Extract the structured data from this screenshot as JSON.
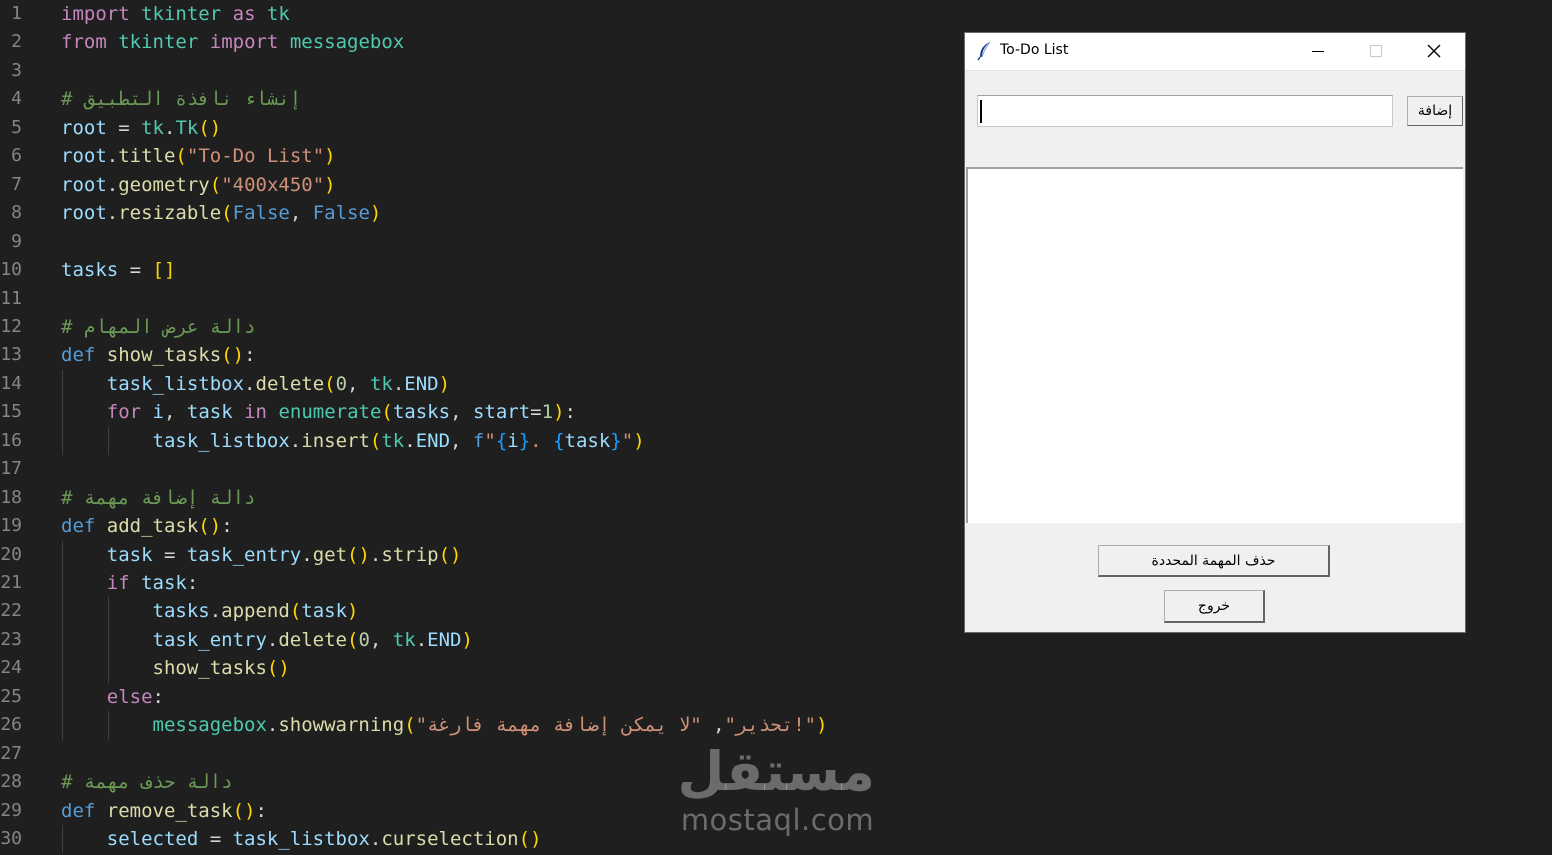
{
  "editor": {
    "line_numbers": [
      "1",
      "2",
      "3",
      "4",
      "5",
      "6",
      "7",
      "8",
      "9",
      "10",
      "11",
      "12",
      "13",
      "14",
      "15",
      "16",
      "17",
      "18",
      "19",
      "20",
      "21",
      "22",
      "23",
      "24",
      "25",
      "26",
      "27",
      "28",
      "29",
      "30"
    ],
    "lines": [
      [
        [
          "kw",
          "import"
        ],
        [
          "pl",
          " "
        ],
        [
          "mod",
          "tkinter"
        ],
        [
          "pl",
          " "
        ],
        [
          "kw",
          "as"
        ],
        [
          "pl",
          " "
        ],
        [
          "mod",
          "tk"
        ]
      ],
      [
        [
          "kw",
          "from"
        ],
        [
          "pl",
          " "
        ],
        [
          "mod",
          "tkinter"
        ],
        [
          "pl",
          " "
        ],
        [
          "kw",
          "import"
        ],
        [
          "pl",
          " "
        ],
        [
          "mod",
          "messagebox"
        ]
      ],
      [],
      [
        [
          "com",
          "# إنشاء نافذة التطبيق"
        ]
      ],
      [
        [
          "var",
          "root"
        ],
        [
          "pl",
          " = "
        ],
        [
          "mod",
          "tk"
        ],
        [
          "pl",
          "."
        ],
        [
          "mod",
          "Tk"
        ],
        [
          "br1",
          "()"
        ]
      ],
      [
        [
          "var",
          "root"
        ],
        [
          "pl",
          "."
        ],
        [
          "fn",
          "title"
        ],
        [
          "br1",
          "("
        ],
        [
          "str",
          "\"To-Do List\""
        ],
        [
          "br1",
          ")"
        ]
      ],
      [
        [
          "var",
          "root"
        ],
        [
          "pl",
          "."
        ],
        [
          "fn",
          "geometry"
        ],
        [
          "br1",
          "("
        ],
        [
          "str",
          "\"400x450\""
        ],
        [
          "br1",
          ")"
        ]
      ],
      [
        [
          "var",
          "root"
        ],
        [
          "pl",
          "."
        ],
        [
          "fn",
          "resizable"
        ],
        [
          "br1",
          "("
        ],
        [
          "bl",
          "False"
        ],
        [
          "pl",
          ", "
        ],
        [
          "bl",
          "False"
        ],
        [
          "br1",
          ")"
        ]
      ],
      [],
      [
        [
          "var",
          "tasks"
        ],
        [
          "pl",
          " = "
        ],
        [
          "br1",
          "[]"
        ]
      ],
      [],
      [
        [
          "com",
          "# دالة عرض المهام"
        ]
      ],
      [
        [
          "bl",
          "def"
        ],
        [
          "pl",
          " "
        ],
        [
          "fn",
          "show_tasks"
        ],
        [
          "br1",
          "()"
        ],
        [
          "pl",
          ":"
        ]
      ],
      [
        [
          "pl",
          "    "
        ],
        [
          "var",
          "task_listbox"
        ],
        [
          "pl",
          "."
        ],
        [
          "fn",
          "delete"
        ],
        [
          "br1",
          "("
        ],
        [
          "num",
          "0"
        ],
        [
          "pl",
          ", "
        ],
        [
          "mod",
          "tk"
        ],
        [
          "pl",
          "."
        ],
        [
          "var",
          "END"
        ],
        [
          "br1",
          ")"
        ]
      ],
      [
        [
          "pl",
          "    "
        ],
        [
          "kw",
          "for"
        ],
        [
          "pl",
          " "
        ],
        [
          "var",
          "i"
        ],
        [
          "pl",
          ", "
        ],
        [
          "var",
          "task"
        ],
        [
          "pl",
          " "
        ],
        [
          "kw",
          "in"
        ],
        [
          "pl",
          " "
        ],
        [
          "mod",
          "enumerate"
        ],
        [
          "br1",
          "("
        ],
        [
          "var",
          "tasks"
        ],
        [
          "pl",
          ", "
        ],
        [
          "var",
          "start"
        ],
        [
          "pl",
          "="
        ],
        [
          "num",
          "1"
        ],
        [
          "br1",
          ")"
        ],
        [
          "pl",
          ":"
        ]
      ],
      [
        [
          "pl",
          "        "
        ],
        [
          "var",
          "task_listbox"
        ],
        [
          "pl",
          "."
        ],
        [
          "fn",
          "insert"
        ],
        [
          "br1",
          "("
        ],
        [
          "mod",
          "tk"
        ],
        [
          "pl",
          "."
        ],
        [
          "var",
          "END"
        ],
        [
          "pl",
          ", "
        ],
        [
          "bl",
          "f"
        ],
        [
          "str",
          "\""
        ],
        [
          "br3",
          "{"
        ],
        [
          "var",
          "i"
        ],
        [
          "br3",
          "}"
        ],
        [
          "str",
          ". "
        ],
        [
          "br3",
          "{"
        ],
        [
          "var",
          "task"
        ],
        [
          "br3",
          "}"
        ],
        [
          "str",
          "\""
        ],
        [
          "br1",
          ")"
        ]
      ],
      [],
      [
        [
          "com",
          "# دالة إضافة مهمة"
        ]
      ],
      [
        [
          "bl",
          "def"
        ],
        [
          "pl",
          " "
        ],
        [
          "fn",
          "add_task"
        ],
        [
          "br1",
          "()"
        ],
        [
          "pl",
          ":"
        ]
      ],
      [
        [
          "pl",
          "    "
        ],
        [
          "var",
          "task"
        ],
        [
          "pl",
          " = "
        ],
        [
          "var",
          "task_entry"
        ],
        [
          "pl",
          "."
        ],
        [
          "fn",
          "get"
        ],
        [
          "br1",
          "()"
        ],
        [
          "pl",
          "."
        ],
        [
          "fn",
          "strip"
        ],
        [
          "br1",
          "()"
        ]
      ],
      [
        [
          "pl",
          "    "
        ],
        [
          "kw",
          "if"
        ],
        [
          "pl",
          " "
        ],
        [
          "var",
          "task"
        ],
        [
          "pl",
          ":"
        ]
      ],
      [
        [
          "pl",
          "        "
        ],
        [
          "var",
          "tasks"
        ],
        [
          "pl",
          "."
        ],
        [
          "fn",
          "append"
        ],
        [
          "br1",
          "("
        ],
        [
          "var",
          "task"
        ],
        [
          "br1",
          ")"
        ]
      ],
      [
        [
          "pl",
          "        "
        ],
        [
          "var",
          "task_entry"
        ],
        [
          "pl",
          "."
        ],
        [
          "fn",
          "delete"
        ],
        [
          "br1",
          "("
        ],
        [
          "num",
          "0"
        ],
        [
          "pl",
          ", "
        ],
        [
          "mod",
          "tk"
        ],
        [
          "pl",
          "."
        ],
        [
          "var",
          "END"
        ],
        [
          "br1",
          ")"
        ]
      ],
      [
        [
          "pl",
          "        "
        ],
        [
          "fn",
          "show_tasks"
        ],
        [
          "br1",
          "()"
        ]
      ],
      [
        [
          "pl",
          "    "
        ],
        [
          "kw",
          "else"
        ],
        [
          "pl",
          ":"
        ]
      ],
      [
        [
          "pl",
          "        "
        ],
        [
          "mod",
          "messagebox"
        ],
        [
          "pl",
          "."
        ],
        [
          "fn",
          "showwarning"
        ],
        [
          "br1",
          "("
        ],
        [
          "str",
          "\"تحذير\""
        ],
        [
          "pl",
          ", "
        ],
        [
          "str",
          "\"لا يمكن إضافة مهمة فارغة!\""
        ],
        [
          "br1",
          ")"
        ]
      ],
      [],
      [
        [
          "com",
          "# دالة حذف مهمة"
        ]
      ],
      [
        [
          "bl",
          "def"
        ],
        [
          "pl",
          " "
        ],
        [
          "fn",
          "remove_task"
        ],
        [
          "br1",
          "()"
        ],
        [
          "pl",
          ":"
        ]
      ],
      [
        [
          "pl",
          "    "
        ],
        [
          "var",
          "selected"
        ],
        [
          "pl",
          " = "
        ],
        [
          "var",
          "task_listbox"
        ],
        [
          "pl",
          "."
        ],
        [
          "fn",
          "curselection"
        ],
        [
          "br1",
          "()"
        ]
      ]
    ]
  },
  "watermark": {
    "arabic": "مستقل",
    "latin": "mostaql.com"
  },
  "window": {
    "title": "To-Do List",
    "add_button_label": "إضافة",
    "entry_value": "",
    "delete_button_label": "حذف المهمة المحددة",
    "exit_button_label": "خروج",
    "icons": {
      "app": "feather-icon",
      "minimize": "minimize-icon",
      "maximize": "maximize-icon",
      "close": "close-icon"
    }
  },
  "colors": {
    "editor_background": "#1f1f1f",
    "window_background": "#f0f0f0"
  }
}
